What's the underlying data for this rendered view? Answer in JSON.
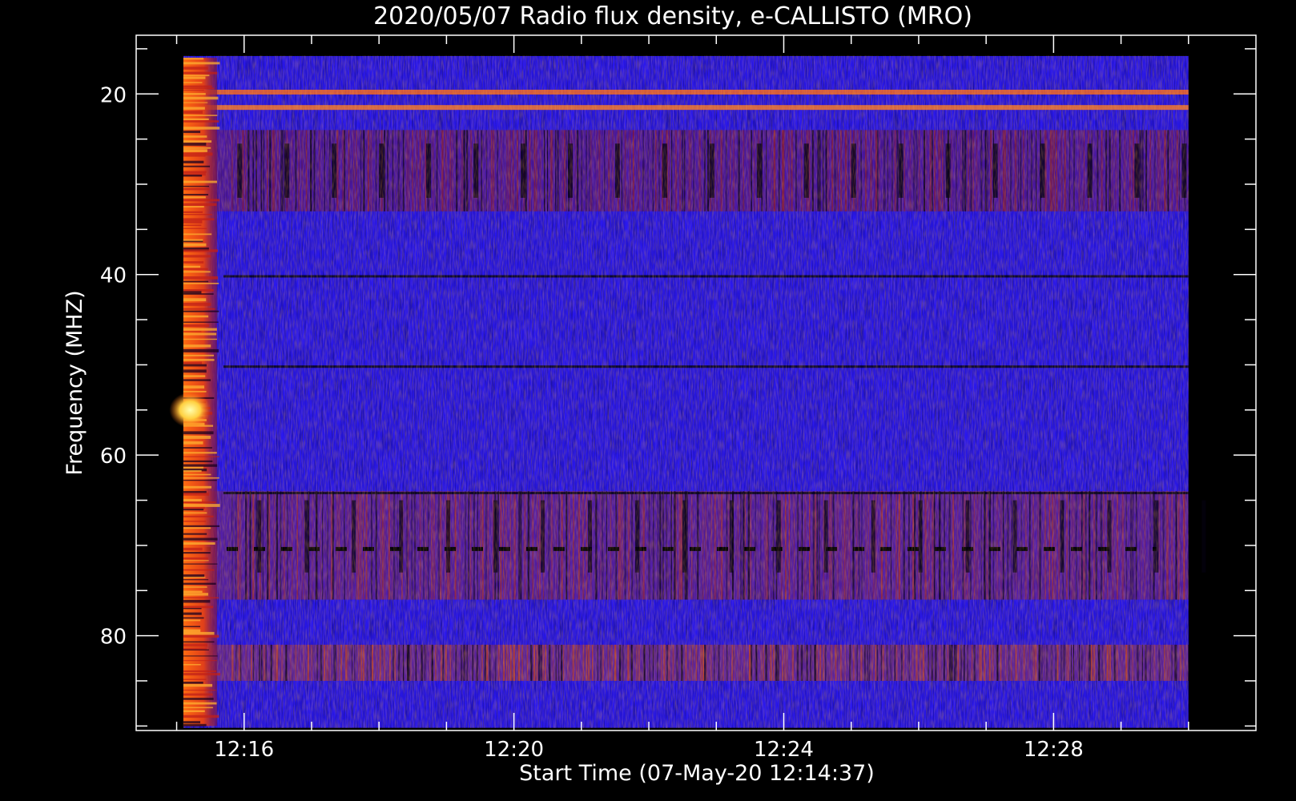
{
  "chart_data": {
    "type": "heatmap",
    "title": "2020/05/07  Radio flux density, e-CALLISTO (MRO)",
    "xlabel": "Start Time (07-May-20 12:14:37)",
    "ylabel": "Frequency (MHZ)",
    "x_ticks": [
      {
        "label": "12:16",
        "minutes": 16
      },
      {
        "label": "12:20",
        "minutes": 20
      },
      {
        "label": "12:24",
        "minutes": 24
      },
      {
        "label": "12:28",
        "minutes": 28
      }
    ],
    "y_ticks": [
      20,
      40,
      60,
      80
    ],
    "xlim_minutes": [
      14.4,
      31.0
    ],
    "ylim": [
      90.5,
      13.5
    ],
    "data_range_minutes": [
      15.1,
      30.0
    ],
    "data_range_mhz": [
      15.8,
      90.2
    ],
    "colormap": [
      "#000000",
      "#1a00c8",
      "#3a1fff",
      "#9a1e3c",
      "#e0501a",
      "#ff9a20",
      "#ffff80"
    ],
    "background_color": "#2a18ee",
    "features": [
      {
        "kind": "burst",
        "time_start_min": 15.1,
        "time_end_min": 15.6,
        "freq_low_mhz": 16,
        "freq_high_mhz": 90,
        "intensity": "high"
      },
      {
        "kind": "hot-spot",
        "time_min": 15.2,
        "freq_mhz": 55,
        "intensity": "max"
      },
      {
        "kind": "interference-band",
        "freq_mhz": 19.8,
        "color": "#ff6a18"
      },
      {
        "kind": "interference-band",
        "freq_mhz": 21.5,
        "color": "#ff7a20"
      },
      {
        "kind": "dark-line",
        "freq_mhz": 40.2
      },
      {
        "kind": "dark-line",
        "freq_mhz": 50.2
      },
      {
        "kind": "dark-line",
        "freq_mhz": 64.2
      },
      {
        "kind": "dashed-line",
        "freq_mhz": 70.4
      },
      {
        "kind": "noisy-band",
        "freq_low_mhz": 24,
        "freq_high_mhz": 33,
        "color": "#8a1a2a"
      },
      {
        "kind": "noisy-band",
        "freq_low_mhz": 64,
        "freq_high_mhz": 76,
        "color": "#a02a30"
      },
      {
        "kind": "noisy-band",
        "freq_low_mhz": 81,
        "freq_high_mhz": 85,
        "color": "#c0401e"
      }
    ]
  }
}
